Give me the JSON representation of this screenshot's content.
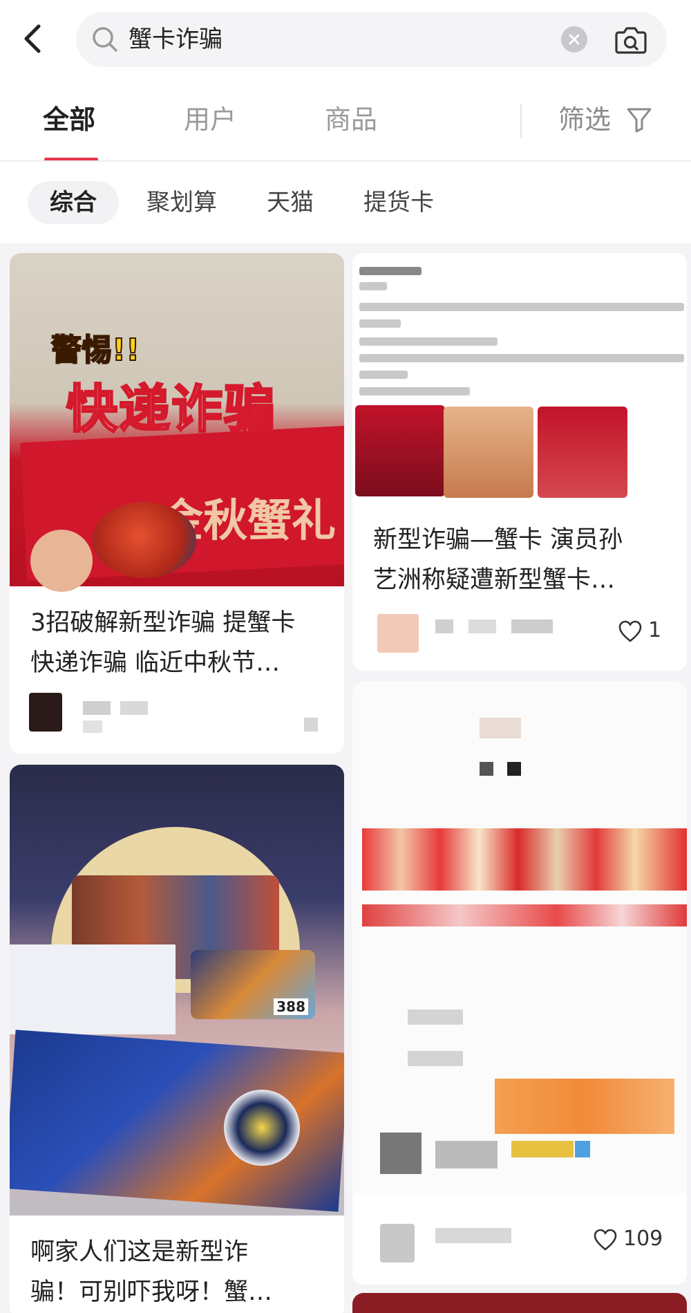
{
  "search": {
    "query": "蟹卡诈骗"
  },
  "tabs": [
    "全部",
    "用户",
    "商品"
  ],
  "filter_label": "筛选",
  "chips": [
    "综合",
    "聚划算",
    "天猫",
    "提货卡"
  ],
  "cards": [
    {
      "title_line1": "3招破解新型诈骗 提蟹卡",
      "title_line2": "快递诈骗 临近中秋节…",
      "image_caption_warn": "警惕!!",
      "image_caption_big": "快递诈骗",
      "image_caption_gold": "金秋蟹礼"
    },
    {
      "title_line1": "新型诈骗—蟹卡 演员孙",
      "title_line2": "艺洲称疑遭新型蟹卡…",
      "likes": "1"
    },
    {
      "title_line1": "啊家人们这是新型诈",
      "title_line2": "骗！可别吓我呀！蟹…",
      "image_price": "388"
    },
    {
      "likes": "109"
    }
  ],
  "colors": {
    "accent": "#e5364a",
    "background": "#f4f4f6"
  }
}
